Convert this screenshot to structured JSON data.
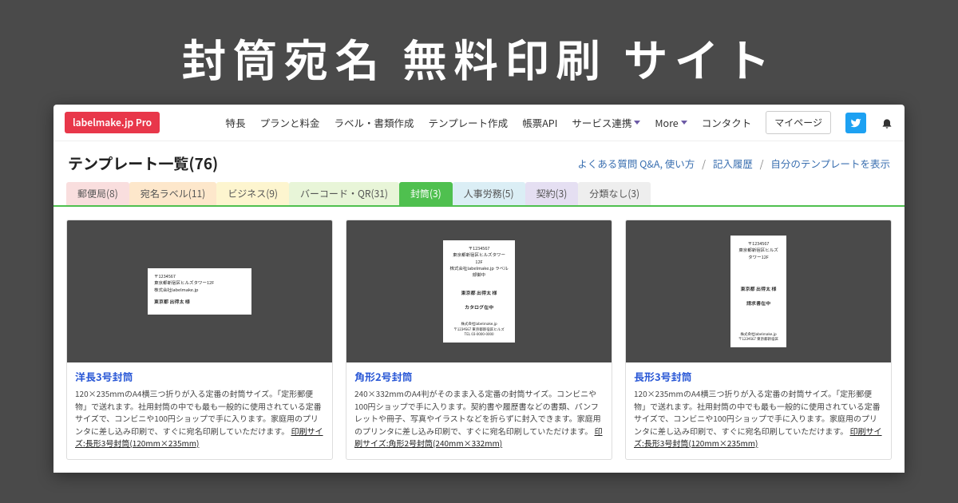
{
  "hero": "封筒宛名  無料印刷  サイト",
  "nav": {
    "logo": "labelmake.jp Pro",
    "items": [
      "特長",
      "プランと料金",
      "ラベル・書類作成",
      "テンプレート作成",
      "帳票API",
      "サービス連携"
    ],
    "more": "More",
    "contact": "コンタクト",
    "mypage": "マイページ"
  },
  "page": {
    "title": "テンプレート一覧(76)",
    "links": [
      "よくある質問 Q&A, 使い方",
      "記入履歴",
      "自分のテンプレートを表示"
    ]
  },
  "tabs": [
    {
      "label": "郵便局(8)",
      "cls": "c1"
    },
    {
      "label": "宛名ラベル(11)",
      "cls": "c2"
    },
    {
      "label": "ビジネス(9)",
      "cls": "c3"
    },
    {
      "label": "バーコード・QR(31)",
      "cls": "c4"
    },
    {
      "label": "封筒(3)",
      "cls": "c5",
      "active": true
    },
    {
      "label": "人事労務(5)",
      "cls": "c6"
    },
    {
      "label": "契約(3)",
      "cls": "c7"
    },
    {
      "label": "分類なし(3)",
      "cls": "c8"
    }
  ],
  "cards": [
    {
      "title": "洋長3号封筒",
      "desc": "120×235mmのA4横三つ折りが入る定番の封筒サイズ。「定形郵便物」で送れます。社用封筒の中でも最も一般的に使用されている定番サイズで、コンビニや100円ショップで手に入ります。家庭用のプリンタに差し込み印刷で、すぐに宛名印刷していただけます。",
      "link": "印刷サイズ:長形3号封筒(120mm×235mm)",
      "env_type": "h",
      "env_top": "〒1234567\n東京都新宿区ヒルズタワー12F\n株式会社labelmake.jp",
      "env_mid": "東京都 出得太 様",
      "env_bot": ""
    },
    {
      "title": "角形2号封筒",
      "desc": "240×332mmのA4判がそのまま入る定番の封筒サイズ。コンビニや100円ショップで手に入ります。契約書や履歴書などの書類、パンフレットや冊子、写真やイラストなどを折らずに封入できます。家庭用のプリンタに差し込み印刷で、すぐに宛名印刷していただけます。",
      "link": "印刷サイズ:角形2号封筒(240mm×332mm)",
      "env_type": "v1",
      "env_top": "〒1234567\n東京都新宿区ヒルズタワー12F\n株式会社labelmake.jp ラベル部御中",
      "env_mid": "東京都 出得太 様\n\nカタログ在中",
      "env_bot": "株式会社labelmake.jp\n〒1234567 東京都新宿区ヒルズ\nTEL 03-0000-0000"
    },
    {
      "title": "長形3号封筒",
      "desc": "120×235mmのA4横三つ折りが入る定番の封筒サイズ。「定形郵便物」で送れます。社用封筒の中でも最も一般的に使用されている定番サイズで、コンビニや100円ショップで手に入ります。家庭用のプリンタに差し込み印刷で、すぐに宛名印刷していただけます。",
      "link": "印刷サイズ:長形3号封筒(120mm×235mm)",
      "env_type": "v2",
      "env_top": "〒1234567\n東京都新宿区ヒルズタワー12F",
      "env_mid": "東京都 出得太 様\n\n請求書在中",
      "env_bot": "株式会社labelmake.jp\n〒1234567 東京都新宿区"
    }
  ]
}
